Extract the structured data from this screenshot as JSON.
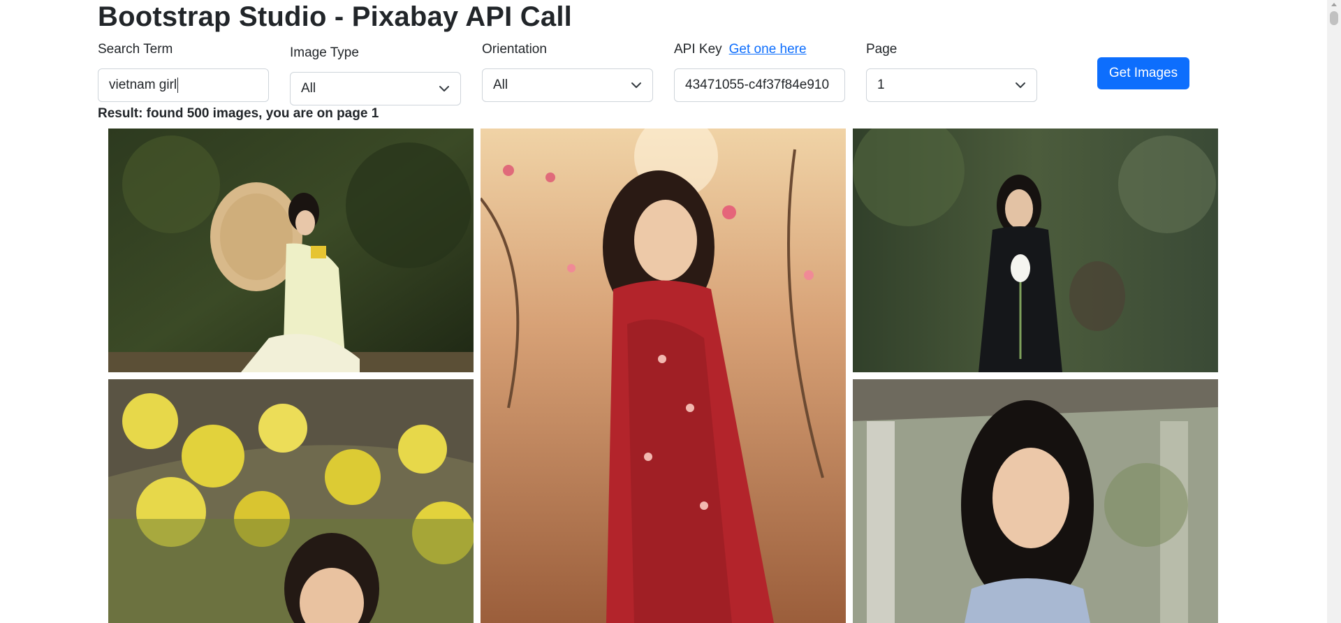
{
  "header": {
    "title": "Bootstrap Studio - Pixabay API Call"
  },
  "form": {
    "search_term": {
      "label": "Search Term",
      "value": "vietnam girl"
    },
    "image_type": {
      "label": "Image Type",
      "selected": "All"
    },
    "orientation": {
      "label": "Orientation",
      "selected": "All"
    },
    "api_key": {
      "label": "API Key",
      "link_text": "Get one here",
      "value": "43471055-c4f37f84e910"
    },
    "page": {
      "label": "Page",
      "selected": "1"
    },
    "submit_label": "Get Images"
  },
  "result": {
    "text": "Result: found 500 images, you are on page 1"
  },
  "icons": {
    "dropdown": "chevron-down-icon"
  },
  "colors": {
    "primary": "#0d6efd",
    "text": "#212529",
    "border": "#ced4da"
  }
}
